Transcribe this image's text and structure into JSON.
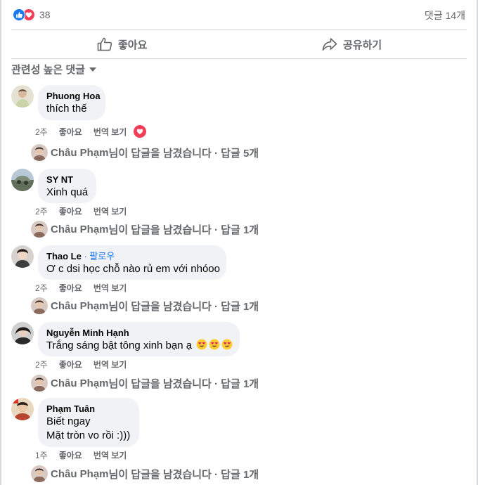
{
  "summary": {
    "reaction_count": "38",
    "comment_count": "댓글 14개"
  },
  "actions": {
    "like": "좋아요",
    "share": "공유하기"
  },
  "sort": {
    "label": "관련성 높은 댓글"
  },
  "labels": {
    "like": "좋아요",
    "translate": "번역 보기",
    "follow": "팔로우"
  },
  "colors": {
    "accent": "#1877f2",
    "love": "#f33e58",
    "bubble": "#f0f2f5",
    "meta_text": "#65676b"
  },
  "comments": [
    {
      "author": "Phuong Hoa",
      "lines": [
        "thích thế"
      ],
      "time": "2주",
      "reply_author": "Châu Phạm",
      "reply_text": "님이 답글을 남겼습니다 · 답글 5개"
    },
    {
      "author": "SY NT",
      "lines": [
        "Xinh quá"
      ],
      "time": "2주",
      "reply_author": "Châu Phạm",
      "reply_text": "님이 답글을 남겼습니다 · 답글 1개"
    },
    {
      "author": "Thao Le",
      "lines": [
        "Ơ c dsi học chỗ nào rủ em với nhóoo"
      ],
      "time": "2주",
      "reply_author": "Châu Phạm",
      "reply_text": "님이 답글을 남겼습니다 · 답글 1개"
    },
    {
      "author": "Nguyễn Minh Hạnh",
      "lines": [
        "Trắng sáng bật tông xinh bạn ạ"
      ],
      "time": "2주",
      "reply_author": "Châu Phạm",
      "reply_text": "님이 답글을 남겼습니다 · 답글 1개"
    },
    {
      "author": "Phạm Tuân",
      "lines": [
        "Biết ngay",
        "Mặt tròn vo rồi :)))"
      ],
      "time": "1주",
      "reply_author": "Châu Phạm",
      "reply_text": "님이 답글을 남겼습니다 · 답글 1개"
    }
  ]
}
